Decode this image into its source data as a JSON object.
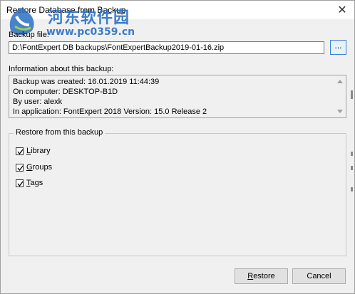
{
  "window": {
    "title": "Restore Database from Backup"
  },
  "watermark": {
    "text_cn": "河东软件园",
    "url": "www.pc0359.cn"
  },
  "backup_file": {
    "label": "Backup file:",
    "value": "D:\\FontExpert DB backups\\FontExpertBackup2019-01-16.zip",
    "browse_label": "..."
  },
  "info": {
    "label": "Information about this backup:",
    "lines": [
      "Backup was created: 16.01.2019 11:44:39",
      "On computer: DESKTOP-B1D",
      "By user: alexk",
      "In application: FontExpert 2018 Version: 15.0 Release 2"
    ]
  },
  "restore_group": {
    "title": "Restore from this backup",
    "items": [
      {
        "first": "L",
        "rest": "ibrary",
        "checked": true
      },
      {
        "first": "G",
        "rest": "roups",
        "checked": true
      },
      {
        "first": "T",
        "rest": "ags",
        "checked": true
      }
    ]
  },
  "buttons": {
    "restore_first": "R",
    "restore_rest": "estore",
    "cancel": "Cancel"
  }
}
